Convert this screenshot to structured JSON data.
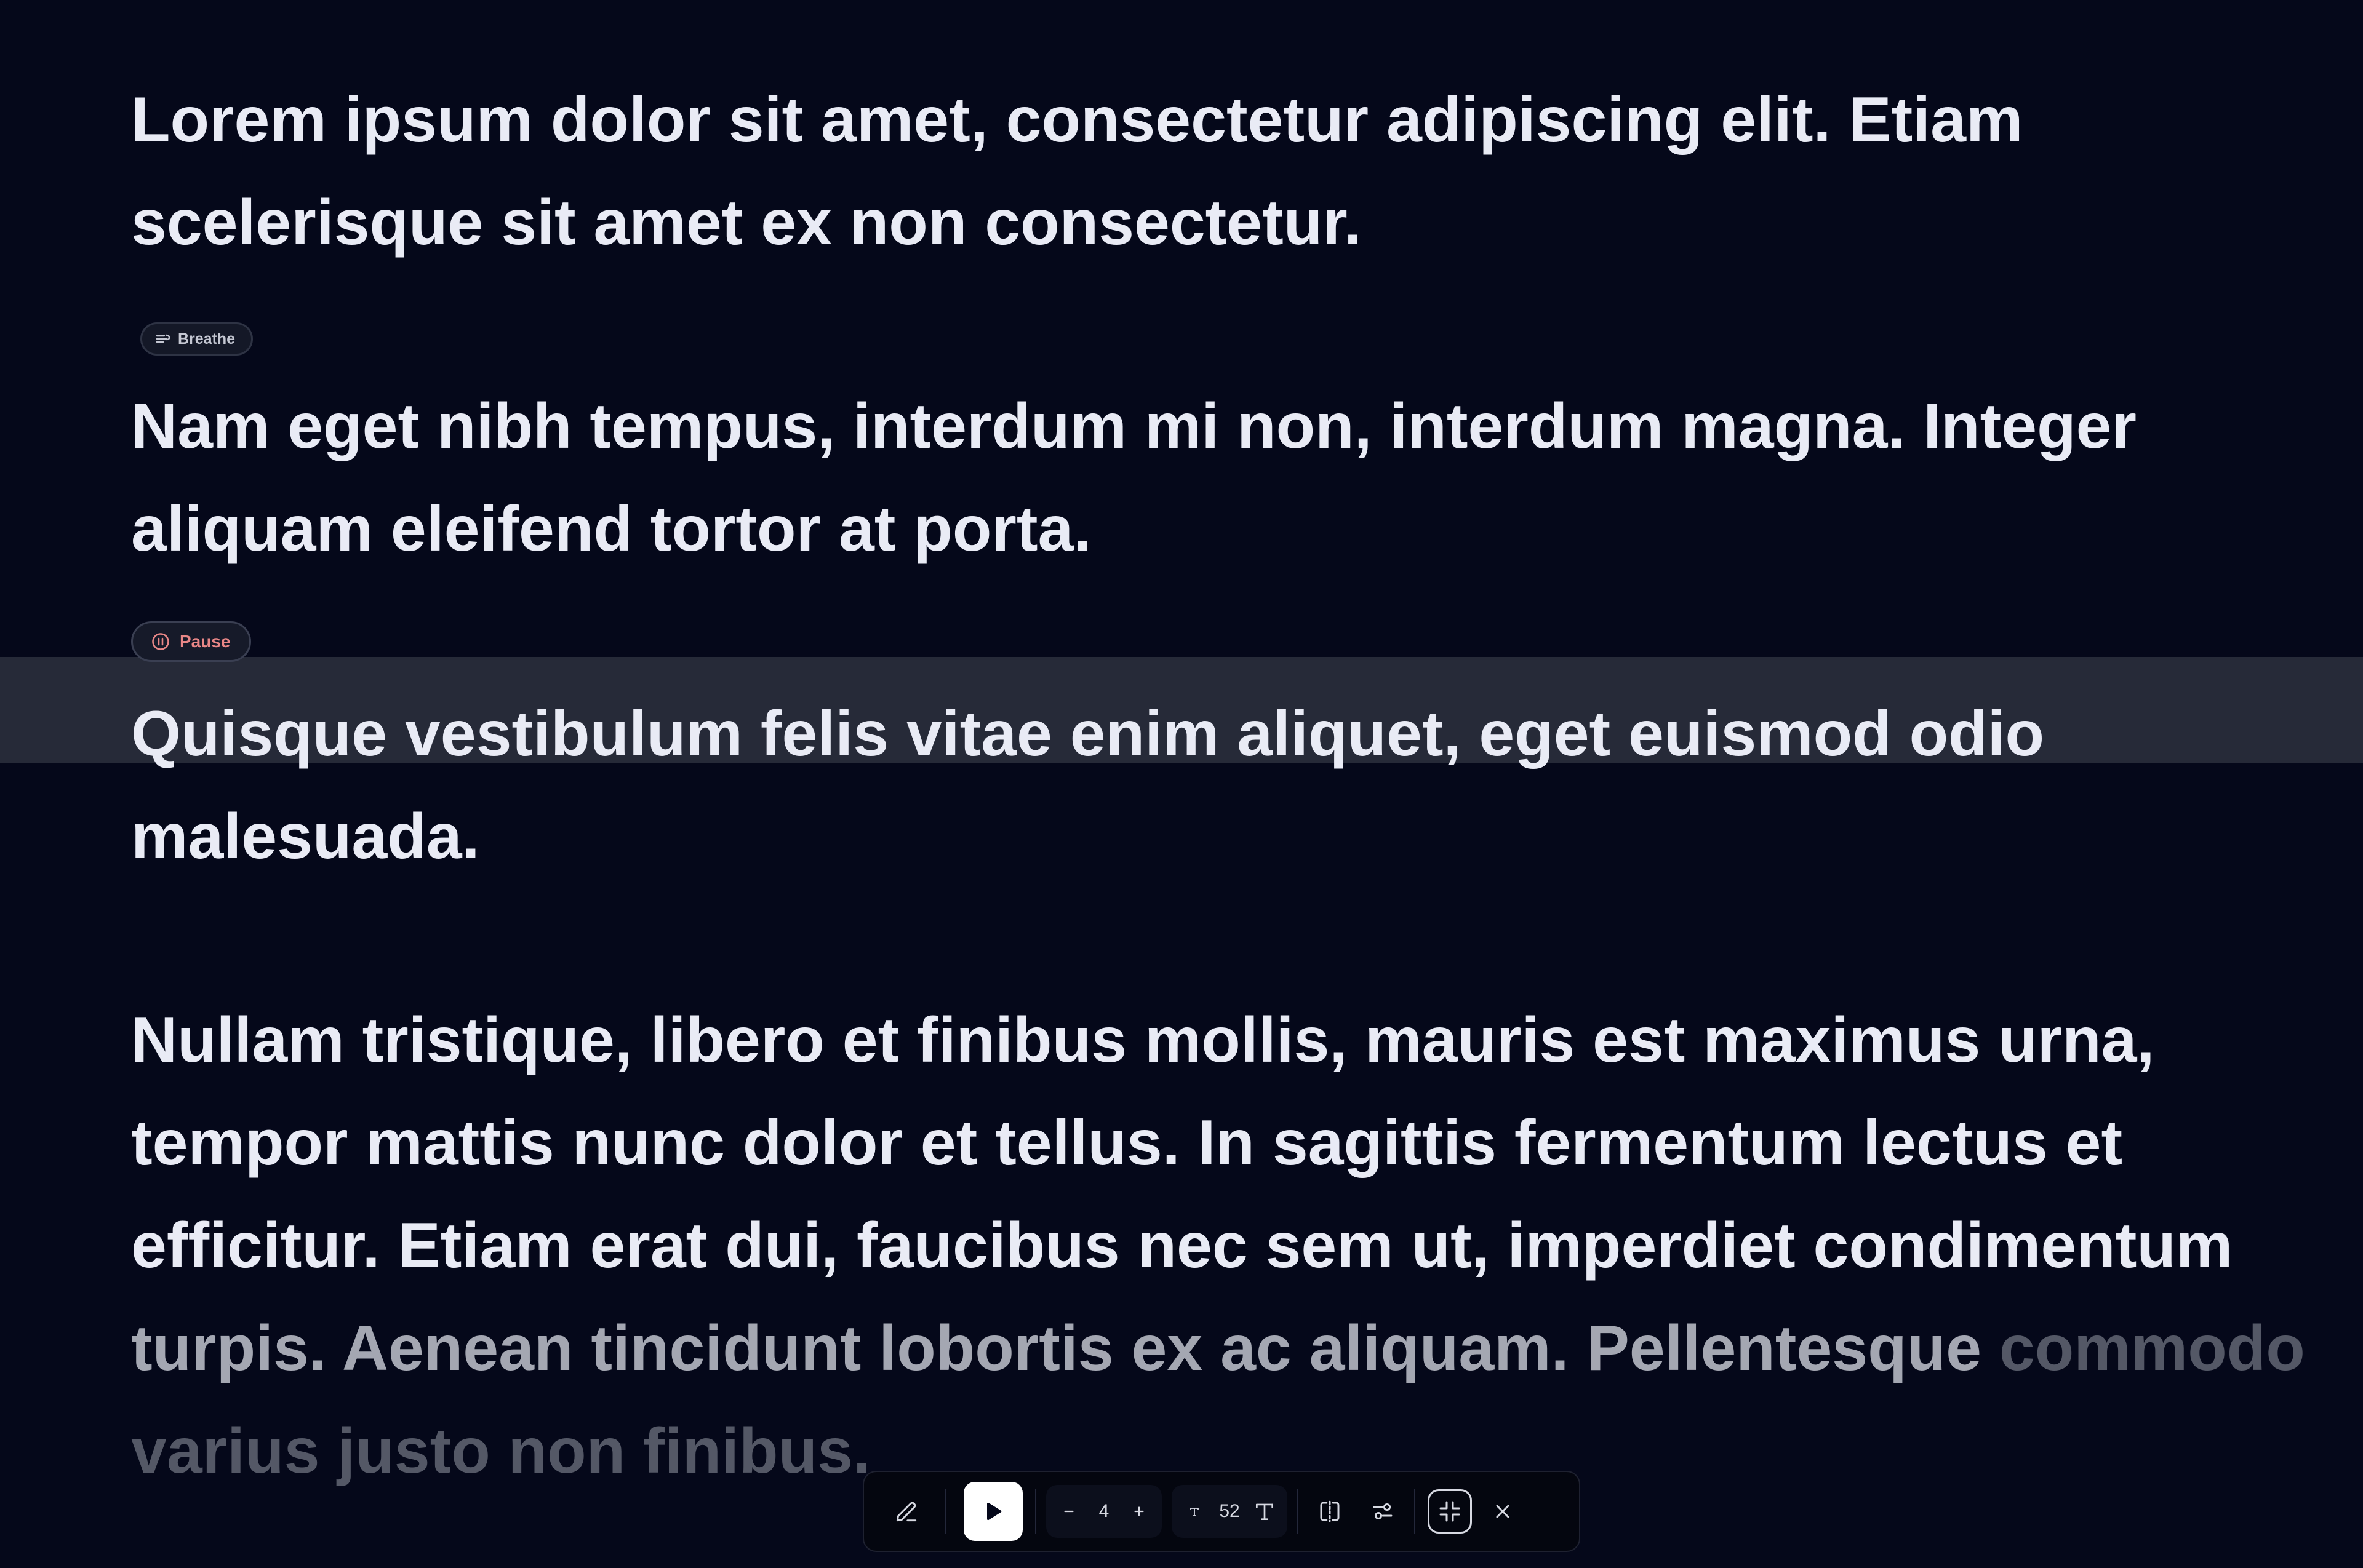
{
  "paragraphs": [
    {
      "text": "Lorem ipsum dolor sit amet, consectetur adipiscing elit. Etiam scelerisque sit amet ex non consectetur."
    },
    {
      "text": "Nam eget nibh tempus, interdum mi non, interdum magna. Integer aliquam eleifend tortor at porta."
    },
    {
      "text": "Quisque vestibulum felis vitae enim aliquet, eget euismod odio malesuada."
    },
    {
      "text_bright": "Nullam tristique, libero et finibus mollis, mauris est maximus urna, tempor mattis nunc dolor et tellus. In sagittis fermentum lectus et efficitur. Etiam erat dui, faucibus nec sem ut, imperdiet condimentum",
      "text_dim": "turpis. Aenean tincidunt lobortis ex ac aliquam. Pellentesque",
      "text_dimmer": "commodo varius justo non finibus."
    }
  ],
  "markers": {
    "breathe_label": "Breathe",
    "pause_label": "Pause"
  },
  "toolbar": {
    "speed_value": "4",
    "font_size_value": "52"
  },
  "icons": {
    "edit": "pencil-icon",
    "play": "play-icon",
    "decrease": "minus-icon",
    "increase": "plus-icon",
    "text_small": "text-small-icon",
    "text_large": "text-large-icon",
    "mirror": "mirror-icon",
    "settings": "sliders-icon",
    "focus": "minimize-icon",
    "close": "close-icon",
    "breathe": "breathe-icon",
    "pause": "pause-circle-icon"
  },
  "colors": {
    "background": "#05081a",
    "text": "#e9ebf5",
    "highlight_band": "#262a38",
    "pause_accent": "#e98787"
  }
}
